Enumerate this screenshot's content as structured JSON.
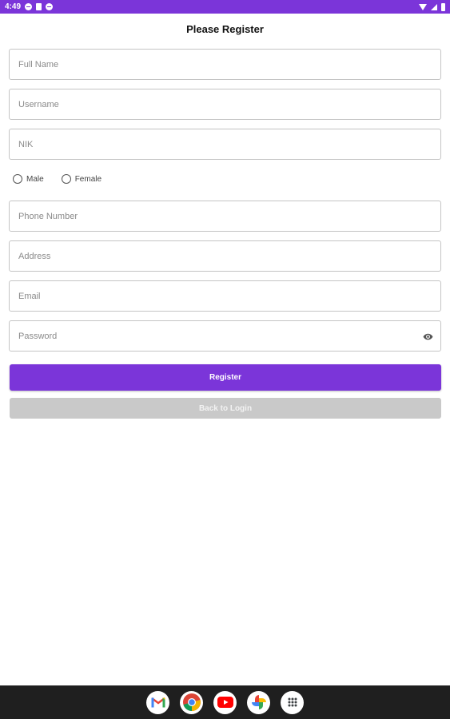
{
  "status_bar": {
    "time": "4:49",
    "icons": [
      "sync-icon",
      "sd-card-icon",
      "sync-icon-2"
    ],
    "right_icons": [
      "wifi-icon",
      "signal-icon",
      "battery-icon"
    ],
    "background": "#7b35d9"
  },
  "page": {
    "title": "Please Register"
  },
  "form": {
    "full_name": {
      "placeholder": "Full Name",
      "value": ""
    },
    "username": {
      "placeholder": "Username",
      "value": ""
    },
    "nik": {
      "placeholder": "NIK",
      "value": ""
    },
    "gender": {
      "options": [
        "Male",
        "Female"
      ],
      "selected": null
    },
    "phone": {
      "placeholder": "Phone Number",
      "value": ""
    },
    "address": {
      "placeholder": "Address",
      "value": ""
    },
    "email": {
      "placeholder": "Email",
      "value": ""
    },
    "password": {
      "placeholder": "Password",
      "value": "",
      "toggle_icon": "eye-icon"
    }
  },
  "buttons": {
    "register_label": "Register",
    "back_label": "Back to Login",
    "register_color": "#7b35d9",
    "back_color": "#c9c9c9"
  },
  "dock": {
    "apps": [
      "gmail-icon",
      "chrome-icon",
      "youtube-icon",
      "photos-icon",
      "app-drawer-icon"
    ]
  }
}
